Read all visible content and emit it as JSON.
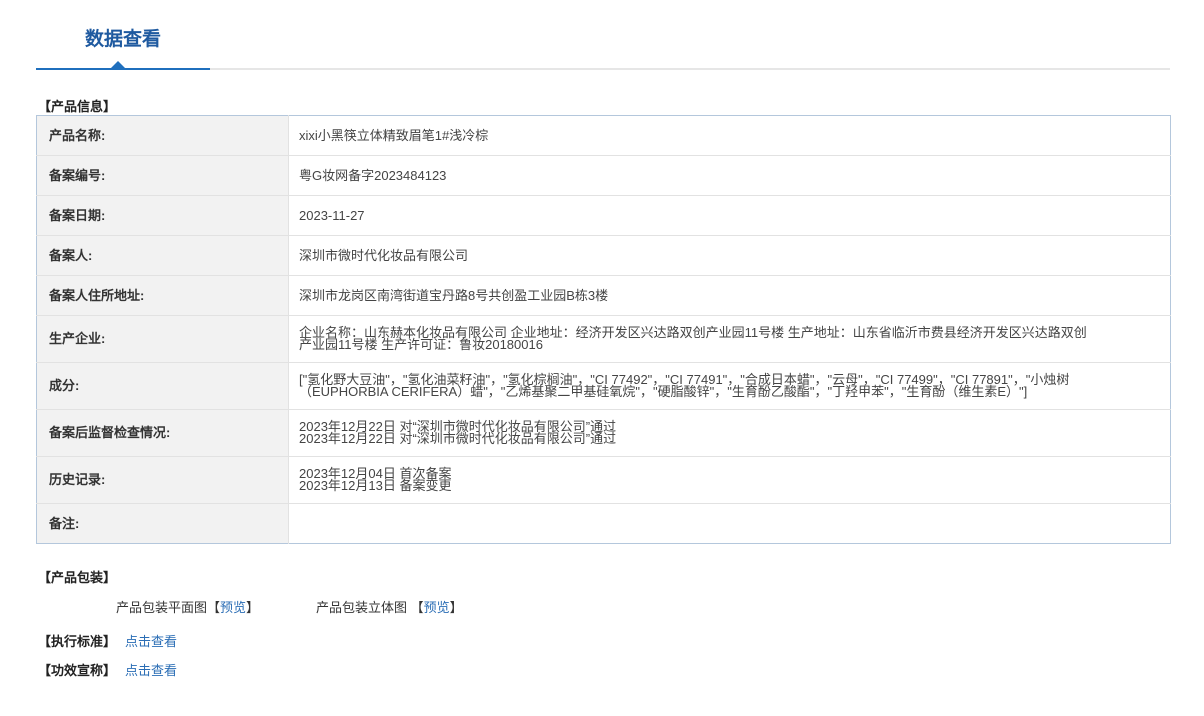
{
  "tab": {
    "label": "数据查看"
  },
  "product_info": {
    "section_title": "【产品信息】",
    "rows": [
      {
        "label": "产品名称:",
        "lines": [
          "xixi小黑筷立体精致眉笔1#浅冷棕"
        ]
      },
      {
        "label": "备案编号:",
        "lines": [
          "粤G妆网备字2023484123"
        ]
      },
      {
        "label": "备案日期:",
        "lines": [
          "2023-11-27"
        ]
      },
      {
        "label": "备案人:",
        "lines": [
          "深圳市微时代化妆品有限公司"
        ]
      },
      {
        "label": "备案人住所地址:",
        "lines": [
          "深圳市龙岗区南湾街道宝丹路8号共创盈工业园B栋3楼"
        ]
      },
      {
        "label": "生产企业:",
        "lines": [
          "企业名称：山东赫本化妆品有限公司 企业地址：经济开发区兴达路双创产业园11号楼 生产地址：山东省临沂市费县经济开发区兴达路双创",
          "产业园11号楼 生产许可证：鲁妆20180016"
        ]
      },
      {
        "label": "成分:",
        "lines": [
          "[\"氢化野大豆油\"，\"氢化油菜籽油\"，\"氢化棕榈油\"，\"CI 77492\"，\"CI 77491\"，\"合成日本蜡\"，\"云母\"，\"CI 77499\"，\"CI 77891\"，\"小烛树",
          "（EUPHORBIA CERIFERA）蜡\"，\"乙烯基聚二甲基硅氧烷\"，\"硬脂酸锌\"，\"生育酚乙酸酯\"，\"丁羟甲苯\"，\"生育酚（维生素E）\"]"
        ]
      },
      {
        "label": "备案后监督检查情况:",
        "lines": [
          "2023年12月22日 对“深圳市微时代化妆品有限公司”通过",
          "2023年12月22日 对“深圳市微时代化妆品有限公司”通过"
        ]
      },
      {
        "label": "历史记录:",
        "lines": [
          "2023年12月04日 首次备案",
          "2023年12月13日 备案变更"
        ]
      },
      {
        "label": "备注:",
        "lines": []
      }
    ]
  },
  "packaging": {
    "section_title": "【产品包装】",
    "flat": {
      "label": "产品包装平面图",
      "open": "【",
      "link": "预览",
      "close": "】"
    },
    "solid": {
      "label": "产品包装立体图",
      "open": "【",
      "link": "预览",
      "close": "】"
    }
  },
  "standard": {
    "section_title": "【执行标准】",
    "link": "点击查看"
  },
  "claim": {
    "section_title": "【功效宣称】",
    "link": "点击查看"
  }
}
